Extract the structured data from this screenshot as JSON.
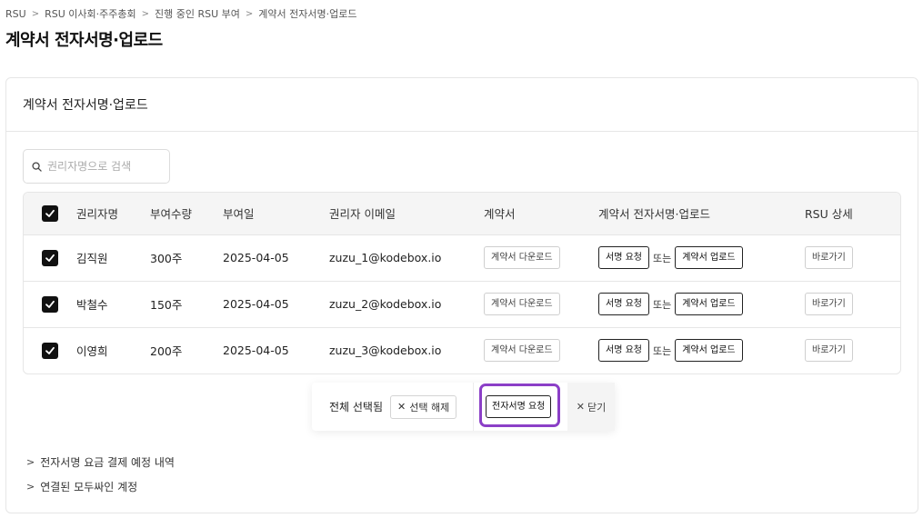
{
  "breadcrumb": [
    "RSU",
    "RSU 이사회·주주총회",
    "진행 중인 RSU 부여",
    "계약서 전자서명·업로드"
  ],
  "page_title": "계약서 전자서명·업로드",
  "card_title": "계약서 전자서명·업로드",
  "search": {
    "placeholder": "권리자명으로 검색",
    "value": ""
  },
  "table": {
    "headers": [
      "권리자명",
      "부여수량",
      "부여일",
      "권리자 이메일",
      "계약서",
      "계약서 전자서명·업로드",
      "RSU 상세"
    ],
    "rows": [
      {
        "name": "김직원",
        "qty": "300주",
        "date": "2025-04-05",
        "email": "zuzu_1@kodebox.io",
        "checked": true
      },
      {
        "name": "박철수",
        "qty": "150주",
        "date": "2025-04-05",
        "email": "zuzu_2@kodebox.io",
        "checked": true
      },
      {
        "name": "이영희",
        "qty": "200주",
        "date": "2025-04-05",
        "email": "zuzu_3@kodebox.io",
        "checked": true
      }
    ],
    "download_label": "계약서 다운로드",
    "sign_request_label": "서명 요청",
    "or_label": "또는",
    "upload_label": "계약서 업로드",
    "detail_label": "바로가기"
  },
  "action_bar": {
    "selected_text": "전체 선택됨",
    "deselect_label": "선택 해제",
    "esign_request_label": "전자서명 요청",
    "close_label": "닫기",
    "highlight_color": "#8b3fc7"
  },
  "accordions": [
    "전자서명 요금 결제 예정 내역",
    "연결된 모두싸인 계정"
  ]
}
